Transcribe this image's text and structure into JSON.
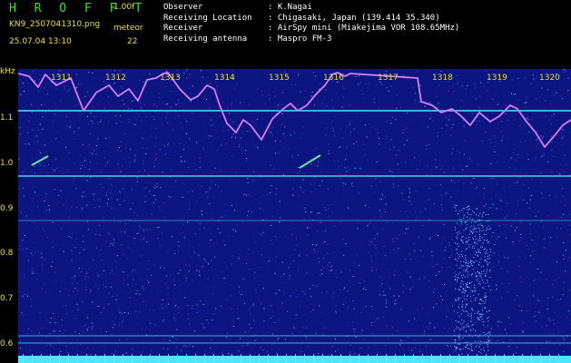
{
  "header": {
    "logo": "H R O F F T",
    "version": "1.00f",
    "filename": "KN9_2507041310.png",
    "meteor_label": "meteor",
    "datetime": "25.07.04 13:10",
    "meteor_count": "22"
  },
  "station": [
    {
      "key": "Observer",
      "value": ": K.Nagai"
    },
    {
      "key": "Receiving Location",
      "value": ": Chigasaki, Japan (139.414 35.340)"
    },
    {
      "key": "Receiver",
      "value": ": AirSpy mini (Miakejima VOR 108.65MHz)"
    },
    {
      "key": "Receiving antenna",
      "value": ": Maspro FM-3"
    }
  ],
  "spectrogram": {
    "y_unit": "kHz",
    "y_ticks": [
      "1.1",
      "1.0",
      "0.9",
      "0.8",
      "0.7",
      "0.6"
    ],
    "minutes": [
      "1311",
      "1312",
      "1313",
      "1314",
      "1315",
      "1316",
      "1317",
      "1318",
      "1319",
      "1320"
    ],
    "colors": {
      "background": "#0d1580",
      "trace": "#b04fe8",
      "hline": "#45c6d8",
      "scale": "#4fe3ff"
    }
  }
}
